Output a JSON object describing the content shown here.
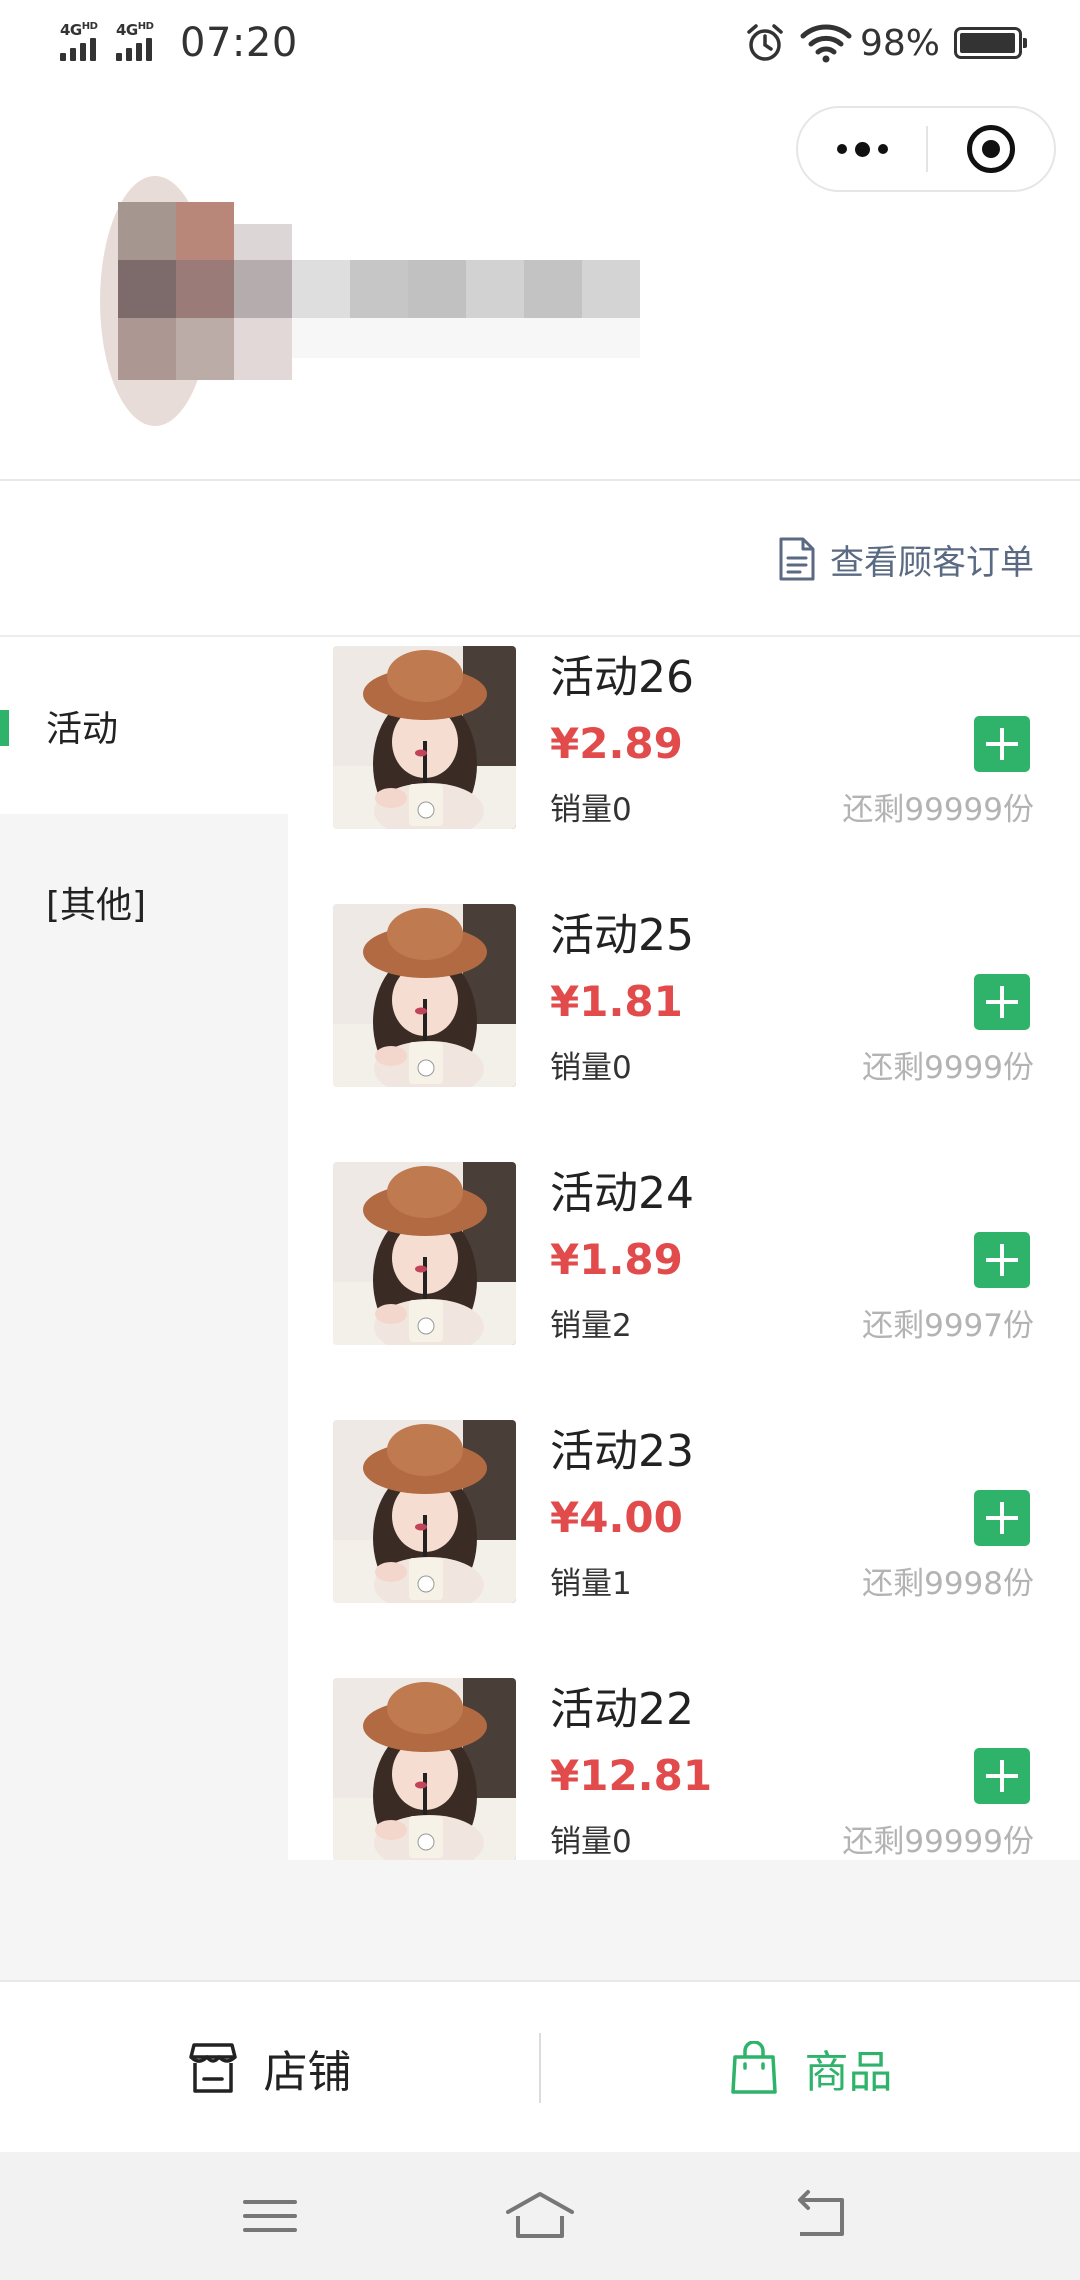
{
  "status_bar": {
    "signal_1": "4G",
    "signal_1_sup": "HD",
    "signal_2": "4G",
    "signal_2_sup": "HD",
    "time": "07:20",
    "battery_text": "98%",
    "battery_level": 0.98,
    "icons": [
      "alarm-icon",
      "wifi-icon",
      "battery-icon"
    ]
  },
  "capsule": {
    "icons": [
      "more-dots-icon",
      "close-target-icon"
    ]
  },
  "orders_link": {
    "label": "查看顾客订单",
    "icon": "document-icon"
  },
  "categories": [
    {
      "label": "活动",
      "active": true
    },
    {
      "label": "[其他]",
      "active": false
    }
  ],
  "products": [
    {
      "name": "活动26",
      "price": "¥2.89",
      "sales": "销量0",
      "stock": "还剩99999份"
    },
    {
      "name": "活动25",
      "price": "¥1.81",
      "sales": "销量0",
      "stock": "还剩9999份"
    },
    {
      "name": "活动24",
      "price": "¥1.89",
      "sales": "销量2",
      "stock": "还剩9997份"
    },
    {
      "name": "活动23",
      "price": "¥4.00",
      "sales": "销量1",
      "stock": "还剩9998份"
    },
    {
      "name": "活动22",
      "price": "¥12.81",
      "sales": "销量0",
      "stock": "还剩99999份"
    }
  ],
  "tabs": [
    {
      "label": "店铺",
      "icon": "store-icon",
      "active": false
    },
    {
      "label": "商品",
      "icon": "shopping-bag-icon",
      "active": true
    }
  ],
  "colors": {
    "accent_green": "#2fb36a",
    "price_red": "#e24b4b",
    "link_gray_blue": "#5a6a82",
    "stock_gray": "#b3b3b3",
    "sidebar_bg": "#f5f5f5"
  },
  "system_nav": {
    "icons": [
      "menu-icon",
      "home-icon",
      "back-icon"
    ]
  }
}
